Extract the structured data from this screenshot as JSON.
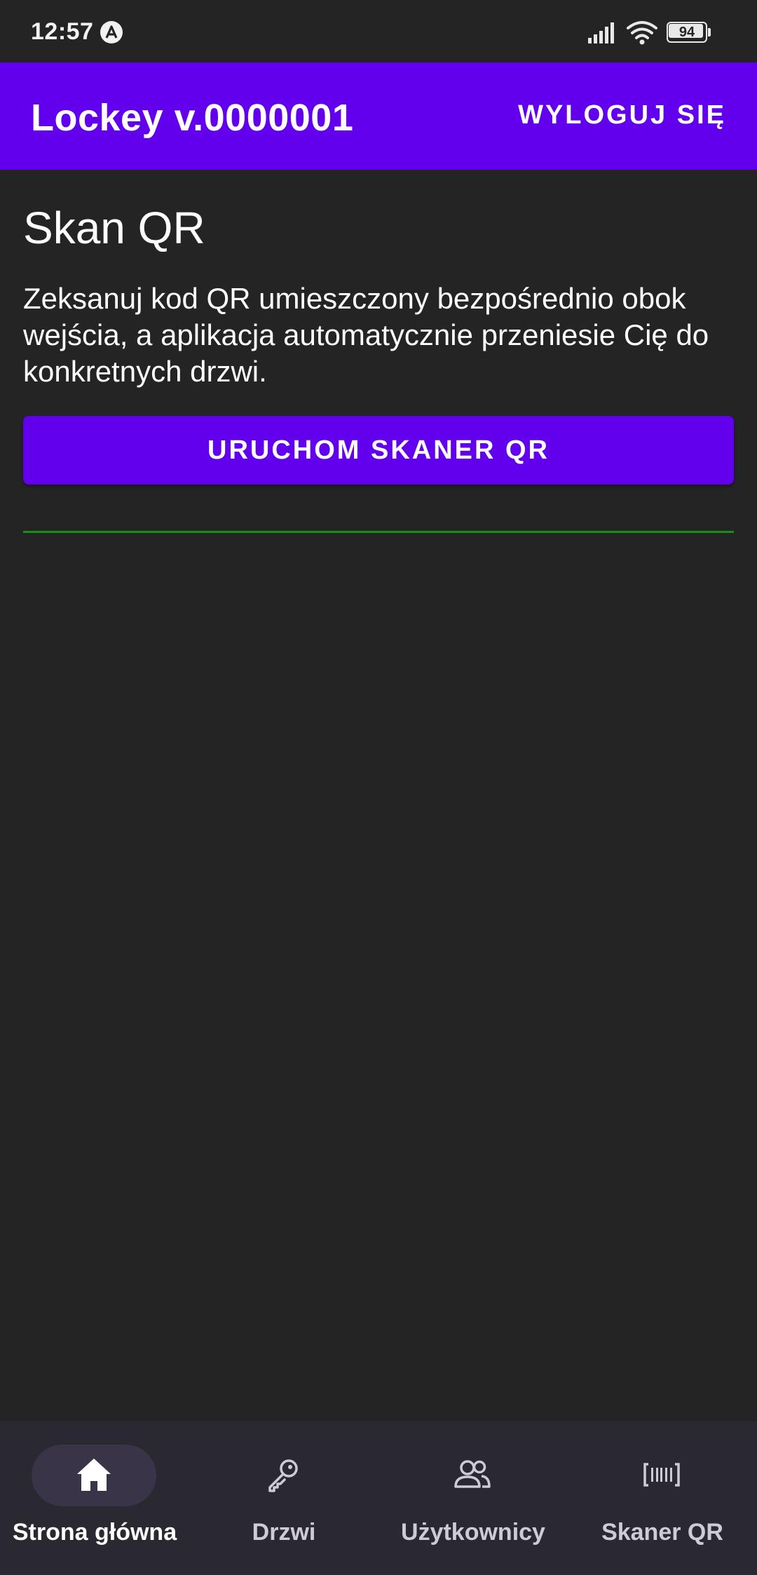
{
  "status_bar": {
    "time": "12:57",
    "battery_level": "94",
    "app_icon": "notification-a-icon",
    "signal_icon": "cellular-signal-icon",
    "wifi_icon": "wifi-icon"
  },
  "app_bar": {
    "title": "Lockey v.0000001",
    "logout_label": "WYLOGUJ SIĘ",
    "color": "#6200ee"
  },
  "main": {
    "heading": "Skan QR",
    "description": "Zeksanuj kod QR umieszczony bezpośrednio obok wejścia, a aplikacja automatycznie przeniesie Cię do konkretnych drzwi.",
    "scan_button_label": "URUCHOM SKANER QR",
    "divider_color": "#1c8a1c"
  },
  "bottom_nav": {
    "items": [
      {
        "label": "Strona główna",
        "icon": "home-icon",
        "active": true
      },
      {
        "label": "Drzwi",
        "icon": "key-icon",
        "active": false
      },
      {
        "label": "Użytkownicy",
        "icon": "users-icon",
        "active": false
      },
      {
        "label": "Skaner QR",
        "icon": "barcode-scanner-icon",
        "active": false
      }
    ]
  },
  "colors": {
    "background": "#242424",
    "accent": "#6200ee",
    "nav_background": "#2a2830",
    "nav_active_pill": "#3a3448"
  }
}
